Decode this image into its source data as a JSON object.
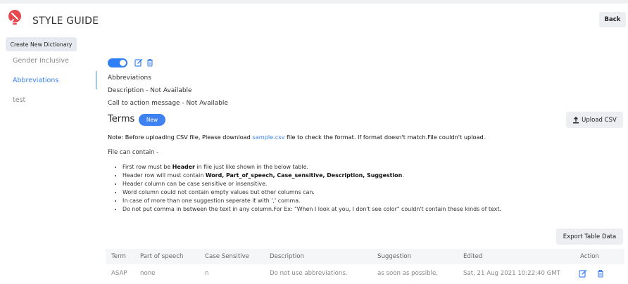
{
  "header": {
    "brand": "STYLE GUIDE",
    "back_label": "Back"
  },
  "sidebar": {
    "create_label": "Create New Dictionary",
    "items": [
      {
        "label": "Gender Inclusive",
        "active": false
      },
      {
        "label": "Abbreviations",
        "active": true
      },
      {
        "label": "test",
        "active": false
      }
    ]
  },
  "dictionary": {
    "enabled": true,
    "name": "Abbreviations",
    "description": "Description - Not Available",
    "cta_message": "Call to action message - Not Available"
  },
  "terms": {
    "title": "Terms",
    "badge": "New",
    "upload_label": "Upload CSV",
    "note_prefix": "Note: Before uploading CSV file, Please download ",
    "note_link": "sample.csv",
    "note_suffix": " file to check the format. If format doesn't match.File couldn't upload.",
    "file_can_contain": "File can contain -",
    "rules": [
      {
        "pre": "First row must be ",
        "bold": "Header",
        "post": " in file just like shown in the below table."
      },
      {
        "pre": "Header row will must contain ",
        "bold": "Word, Part_of_speech, Case_sensitive, Description, Suggestion",
        "post": "."
      },
      {
        "pre": "Header column can be case sensitive or insensitive.",
        "bold": "",
        "post": ""
      },
      {
        "pre": "Word column could not contain empty values but other columns can.",
        "bold": "",
        "post": ""
      },
      {
        "pre": "In case of more than one suggestion seperate it with ',' comma.",
        "bold": "",
        "post": ""
      },
      {
        "pre": "Do not put comma in between the text in any column.For Ex: \"When I look at you, I don't see color\" couldn't contain these kinds of text.",
        "bold": "",
        "post": ""
      }
    ],
    "export_label": "Export Table Data"
  },
  "table": {
    "columns": [
      "Term",
      "Part of speech",
      "Case Sensitive",
      "Description",
      "Suggestion",
      "Edited",
      "Action"
    ],
    "rows": [
      {
        "term": "ASAP",
        "part_of_speech": "none",
        "case_sensitive": "n",
        "description": "Do not use abbreviations.",
        "suggestion": "as soon as possible,",
        "edited": "Sat, 21 Aug 2021 10:22:40 GMT"
      }
    ]
  },
  "icons": {
    "logo": "brand-logo-icon",
    "edit": "edit-icon",
    "delete": "trash-icon",
    "upload": "upload-icon"
  },
  "colors": {
    "accent": "#3d82f0",
    "logo": "#e5484d",
    "button_bg": "#eceef1"
  }
}
